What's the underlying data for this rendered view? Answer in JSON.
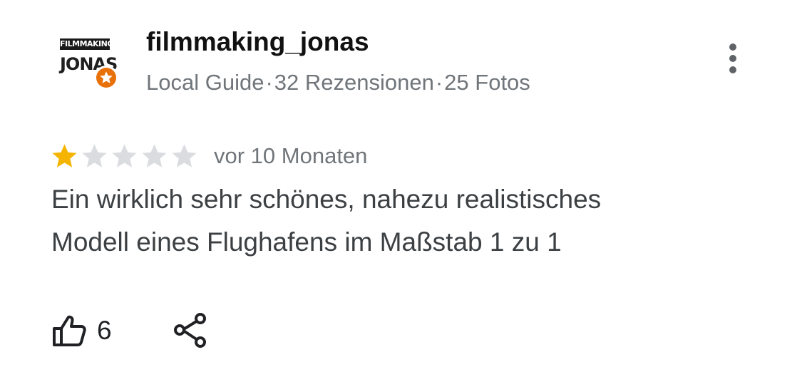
{
  "reviewer": {
    "name": "filmmaking_jonas",
    "avatar_logo_top": "FILMMAKING",
    "avatar_logo_bottom": "JONAS",
    "level": "Local Guide",
    "reviews": "32 Rezensionen",
    "photos": "25 Fotos",
    "separator": "·"
  },
  "review": {
    "rating": 1,
    "max_rating": 5,
    "date": "vor 10 Monaten",
    "text_line1": "Ein wirklich sehr schönes, nahezu realistisches",
    "text_line2": "Modell eines Flughafens im Maßstab 1 zu 1"
  },
  "actions": {
    "like_count": "6",
    "like_icon": "thumbs-up-icon",
    "share_icon": "share-icon",
    "more_icon": "more-vert-icon"
  },
  "colors": {
    "star_filled": "#f4b400",
    "star_empty": "#dadce0",
    "badge": "#e8710a",
    "meta_text": "#70757a"
  }
}
